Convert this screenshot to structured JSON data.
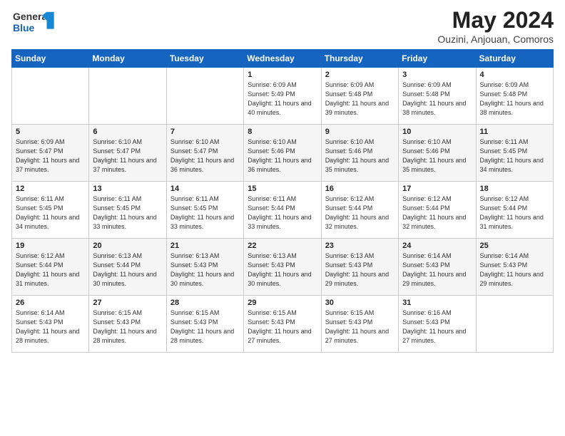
{
  "header": {
    "logo_line1": "General",
    "logo_line2": "Blue",
    "title": "May 2024",
    "subtitle": "Ouzini, Anjouan, Comoros"
  },
  "weekdays": [
    "Sunday",
    "Monday",
    "Tuesday",
    "Wednesday",
    "Thursday",
    "Friday",
    "Saturday"
  ],
  "weeks": [
    [
      {
        "day": "",
        "sunrise": "",
        "sunset": "",
        "daylight": ""
      },
      {
        "day": "",
        "sunrise": "",
        "sunset": "",
        "daylight": ""
      },
      {
        "day": "",
        "sunrise": "",
        "sunset": "",
        "daylight": ""
      },
      {
        "day": "1",
        "sunrise": "6:09 AM",
        "sunset": "5:49 PM",
        "daylight": "11 hours and 40 minutes."
      },
      {
        "day": "2",
        "sunrise": "6:09 AM",
        "sunset": "5:48 PM",
        "daylight": "11 hours and 39 minutes."
      },
      {
        "day": "3",
        "sunrise": "6:09 AM",
        "sunset": "5:48 PM",
        "daylight": "11 hours and 38 minutes."
      },
      {
        "day": "4",
        "sunrise": "6:09 AM",
        "sunset": "5:48 PM",
        "daylight": "11 hours and 38 minutes."
      }
    ],
    [
      {
        "day": "5",
        "sunrise": "6:09 AM",
        "sunset": "5:47 PM",
        "daylight": "11 hours and 37 minutes."
      },
      {
        "day": "6",
        "sunrise": "6:10 AM",
        "sunset": "5:47 PM",
        "daylight": "11 hours and 37 minutes."
      },
      {
        "day": "7",
        "sunrise": "6:10 AM",
        "sunset": "5:47 PM",
        "daylight": "11 hours and 36 minutes."
      },
      {
        "day": "8",
        "sunrise": "6:10 AM",
        "sunset": "5:46 PM",
        "daylight": "11 hours and 36 minutes."
      },
      {
        "day": "9",
        "sunrise": "6:10 AM",
        "sunset": "5:46 PM",
        "daylight": "11 hours and 35 minutes."
      },
      {
        "day": "10",
        "sunrise": "6:10 AM",
        "sunset": "5:46 PM",
        "daylight": "11 hours and 35 minutes."
      },
      {
        "day": "11",
        "sunrise": "6:11 AM",
        "sunset": "5:45 PM",
        "daylight": "11 hours and 34 minutes."
      }
    ],
    [
      {
        "day": "12",
        "sunrise": "6:11 AM",
        "sunset": "5:45 PM",
        "daylight": "11 hours and 34 minutes."
      },
      {
        "day": "13",
        "sunrise": "6:11 AM",
        "sunset": "5:45 PM",
        "daylight": "11 hours and 33 minutes."
      },
      {
        "day": "14",
        "sunrise": "6:11 AM",
        "sunset": "5:45 PM",
        "daylight": "11 hours and 33 minutes."
      },
      {
        "day": "15",
        "sunrise": "6:11 AM",
        "sunset": "5:44 PM",
        "daylight": "11 hours and 33 minutes."
      },
      {
        "day": "16",
        "sunrise": "6:12 AM",
        "sunset": "5:44 PM",
        "daylight": "11 hours and 32 minutes."
      },
      {
        "day": "17",
        "sunrise": "6:12 AM",
        "sunset": "5:44 PM",
        "daylight": "11 hours and 32 minutes."
      },
      {
        "day": "18",
        "sunrise": "6:12 AM",
        "sunset": "5:44 PM",
        "daylight": "11 hours and 31 minutes."
      }
    ],
    [
      {
        "day": "19",
        "sunrise": "6:12 AM",
        "sunset": "5:44 PM",
        "daylight": "11 hours and 31 minutes."
      },
      {
        "day": "20",
        "sunrise": "6:13 AM",
        "sunset": "5:44 PM",
        "daylight": "11 hours and 30 minutes."
      },
      {
        "day": "21",
        "sunrise": "6:13 AM",
        "sunset": "5:43 PM",
        "daylight": "11 hours and 30 minutes."
      },
      {
        "day": "22",
        "sunrise": "6:13 AM",
        "sunset": "5:43 PM",
        "daylight": "11 hours and 30 minutes."
      },
      {
        "day": "23",
        "sunrise": "6:13 AM",
        "sunset": "5:43 PM",
        "daylight": "11 hours and 29 minutes."
      },
      {
        "day": "24",
        "sunrise": "6:14 AM",
        "sunset": "5:43 PM",
        "daylight": "11 hours and 29 minutes."
      },
      {
        "day": "25",
        "sunrise": "6:14 AM",
        "sunset": "5:43 PM",
        "daylight": "11 hours and 29 minutes."
      }
    ],
    [
      {
        "day": "26",
        "sunrise": "6:14 AM",
        "sunset": "5:43 PM",
        "daylight": "11 hours and 28 minutes."
      },
      {
        "day": "27",
        "sunrise": "6:15 AM",
        "sunset": "5:43 PM",
        "daylight": "11 hours and 28 minutes."
      },
      {
        "day": "28",
        "sunrise": "6:15 AM",
        "sunset": "5:43 PM",
        "daylight": "11 hours and 28 minutes."
      },
      {
        "day": "29",
        "sunrise": "6:15 AM",
        "sunset": "5:43 PM",
        "daylight": "11 hours and 27 minutes."
      },
      {
        "day": "30",
        "sunrise": "6:15 AM",
        "sunset": "5:43 PM",
        "daylight": "11 hours and 27 minutes."
      },
      {
        "day": "31",
        "sunrise": "6:16 AM",
        "sunset": "5:43 PM",
        "daylight": "11 hours and 27 minutes."
      },
      {
        "day": "",
        "sunrise": "",
        "sunset": "",
        "daylight": ""
      }
    ]
  ],
  "labels": {
    "sunrise_prefix": "Sunrise: ",
    "sunset_prefix": "Sunset: ",
    "daylight_prefix": "Daylight: "
  }
}
